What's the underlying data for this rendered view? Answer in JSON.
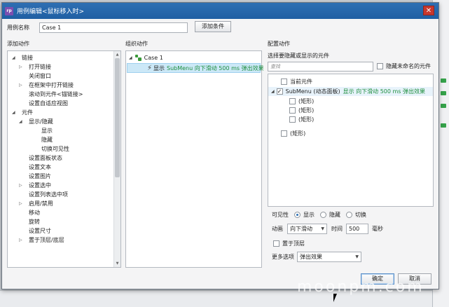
{
  "window": {
    "title": "用例编辑<鼠标移入时>",
    "app_icon": "rp",
    "close_icon": "✕"
  },
  "case_name": {
    "label": "用例名称",
    "value": "Case 1",
    "add_condition_label": "添加条件"
  },
  "sections": {
    "add_action": "添加动作",
    "organize_action": "组织动作",
    "configure_action": "配置动作"
  },
  "left_tree": [
    {
      "label": "链接",
      "level": 0,
      "arrow": "down"
    },
    {
      "label": "打开链接",
      "level": 1,
      "arrow": "right"
    },
    {
      "label": "关闭窗口",
      "level": 1,
      "arrow": "none"
    },
    {
      "label": "在框架中打开链接",
      "level": 1,
      "arrow": "right"
    },
    {
      "label": "滚动到元件<锚链接>",
      "level": 1,
      "arrow": "none"
    },
    {
      "label": "设置自适应视图",
      "level": 1,
      "arrow": "none"
    },
    {
      "label": "元件",
      "level": 0,
      "arrow": "down"
    },
    {
      "label": "显示/隐藏",
      "level": 1,
      "arrow": "down"
    },
    {
      "label": "显示",
      "level": 2,
      "arrow": "none"
    },
    {
      "label": "隐藏",
      "level": 2,
      "arrow": "none"
    },
    {
      "label": "切换可见性",
      "level": 2,
      "arrow": "none"
    },
    {
      "label": "设置面板状态",
      "level": 1,
      "arrow": "none"
    },
    {
      "label": "设置文本",
      "level": 1,
      "arrow": "none"
    },
    {
      "label": "设置图片",
      "level": 1,
      "arrow": "none"
    },
    {
      "label": "设置选中",
      "level": 1,
      "arrow": "right"
    },
    {
      "label": "设置列表选中项",
      "level": 1,
      "arrow": "none"
    },
    {
      "label": "启用/禁用",
      "level": 1,
      "arrow": "right"
    },
    {
      "label": "移动",
      "level": 1,
      "arrow": "none"
    },
    {
      "label": "旋转",
      "level": 1,
      "arrow": "none"
    },
    {
      "label": "设置尺寸",
      "level": 1,
      "arrow": "none"
    },
    {
      "label": "置于顶层/底层",
      "level": 1,
      "arrow": "right"
    }
  ],
  "organize": {
    "case_label": "Case 1",
    "action_verb": "显示",
    "action_detail": "SubMenu 向下滑动 500 ms 弹出效果"
  },
  "configure": {
    "choose_label": "选择要隐藏或显示的元件",
    "search_placeholder": "查找",
    "hide_unnamed_label": "隐藏未命名的元件",
    "widgets": [
      {
        "label": "当前元件",
        "indent": 1,
        "checked": false,
        "arrow": false,
        "detail": "",
        "selected": false
      },
      {
        "label": "SubMenu (动态面板)",
        "indent": 0,
        "checked": true,
        "arrow": true,
        "detail": "显示 向下滑动 500 ms 弹出效果",
        "selected": true
      },
      {
        "label": "(矩形)",
        "indent": 2,
        "checked": false,
        "arrow": false,
        "detail": "",
        "selected": false
      },
      {
        "label": "(矩形)",
        "indent": 2,
        "checked": false,
        "arrow": false,
        "detail": "",
        "selected": false
      },
      {
        "label": "(矩形)",
        "indent": 2,
        "checked": false,
        "arrow": false,
        "detail": "",
        "selected": false
      },
      {
        "label": "(矩形)",
        "indent": 1,
        "checked": false,
        "arrow": false,
        "detail": "",
        "selected": false
      }
    ],
    "visibility_label": "可见性",
    "visibility_options": [
      "显示",
      "隐藏",
      "切换"
    ],
    "visibility_selected": "显示",
    "animation_label": "动画",
    "animation_value": "向下滑动",
    "time_label": "时间",
    "time_value": "500",
    "time_unit": "毫秒",
    "bring_to_front_label": "置于顶层",
    "more_options_label": "更多选项",
    "more_options_value": "弹出效果"
  },
  "buttons": {
    "ok": "确定",
    "cancel": "取消"
  },
  "watermark": "moonpm.com",
  "colors": {
    "titlebar": "#1f5fa3",
    "selection": "#cce8f7",
    "action_detail": "#1f8f3f"
  }
}
